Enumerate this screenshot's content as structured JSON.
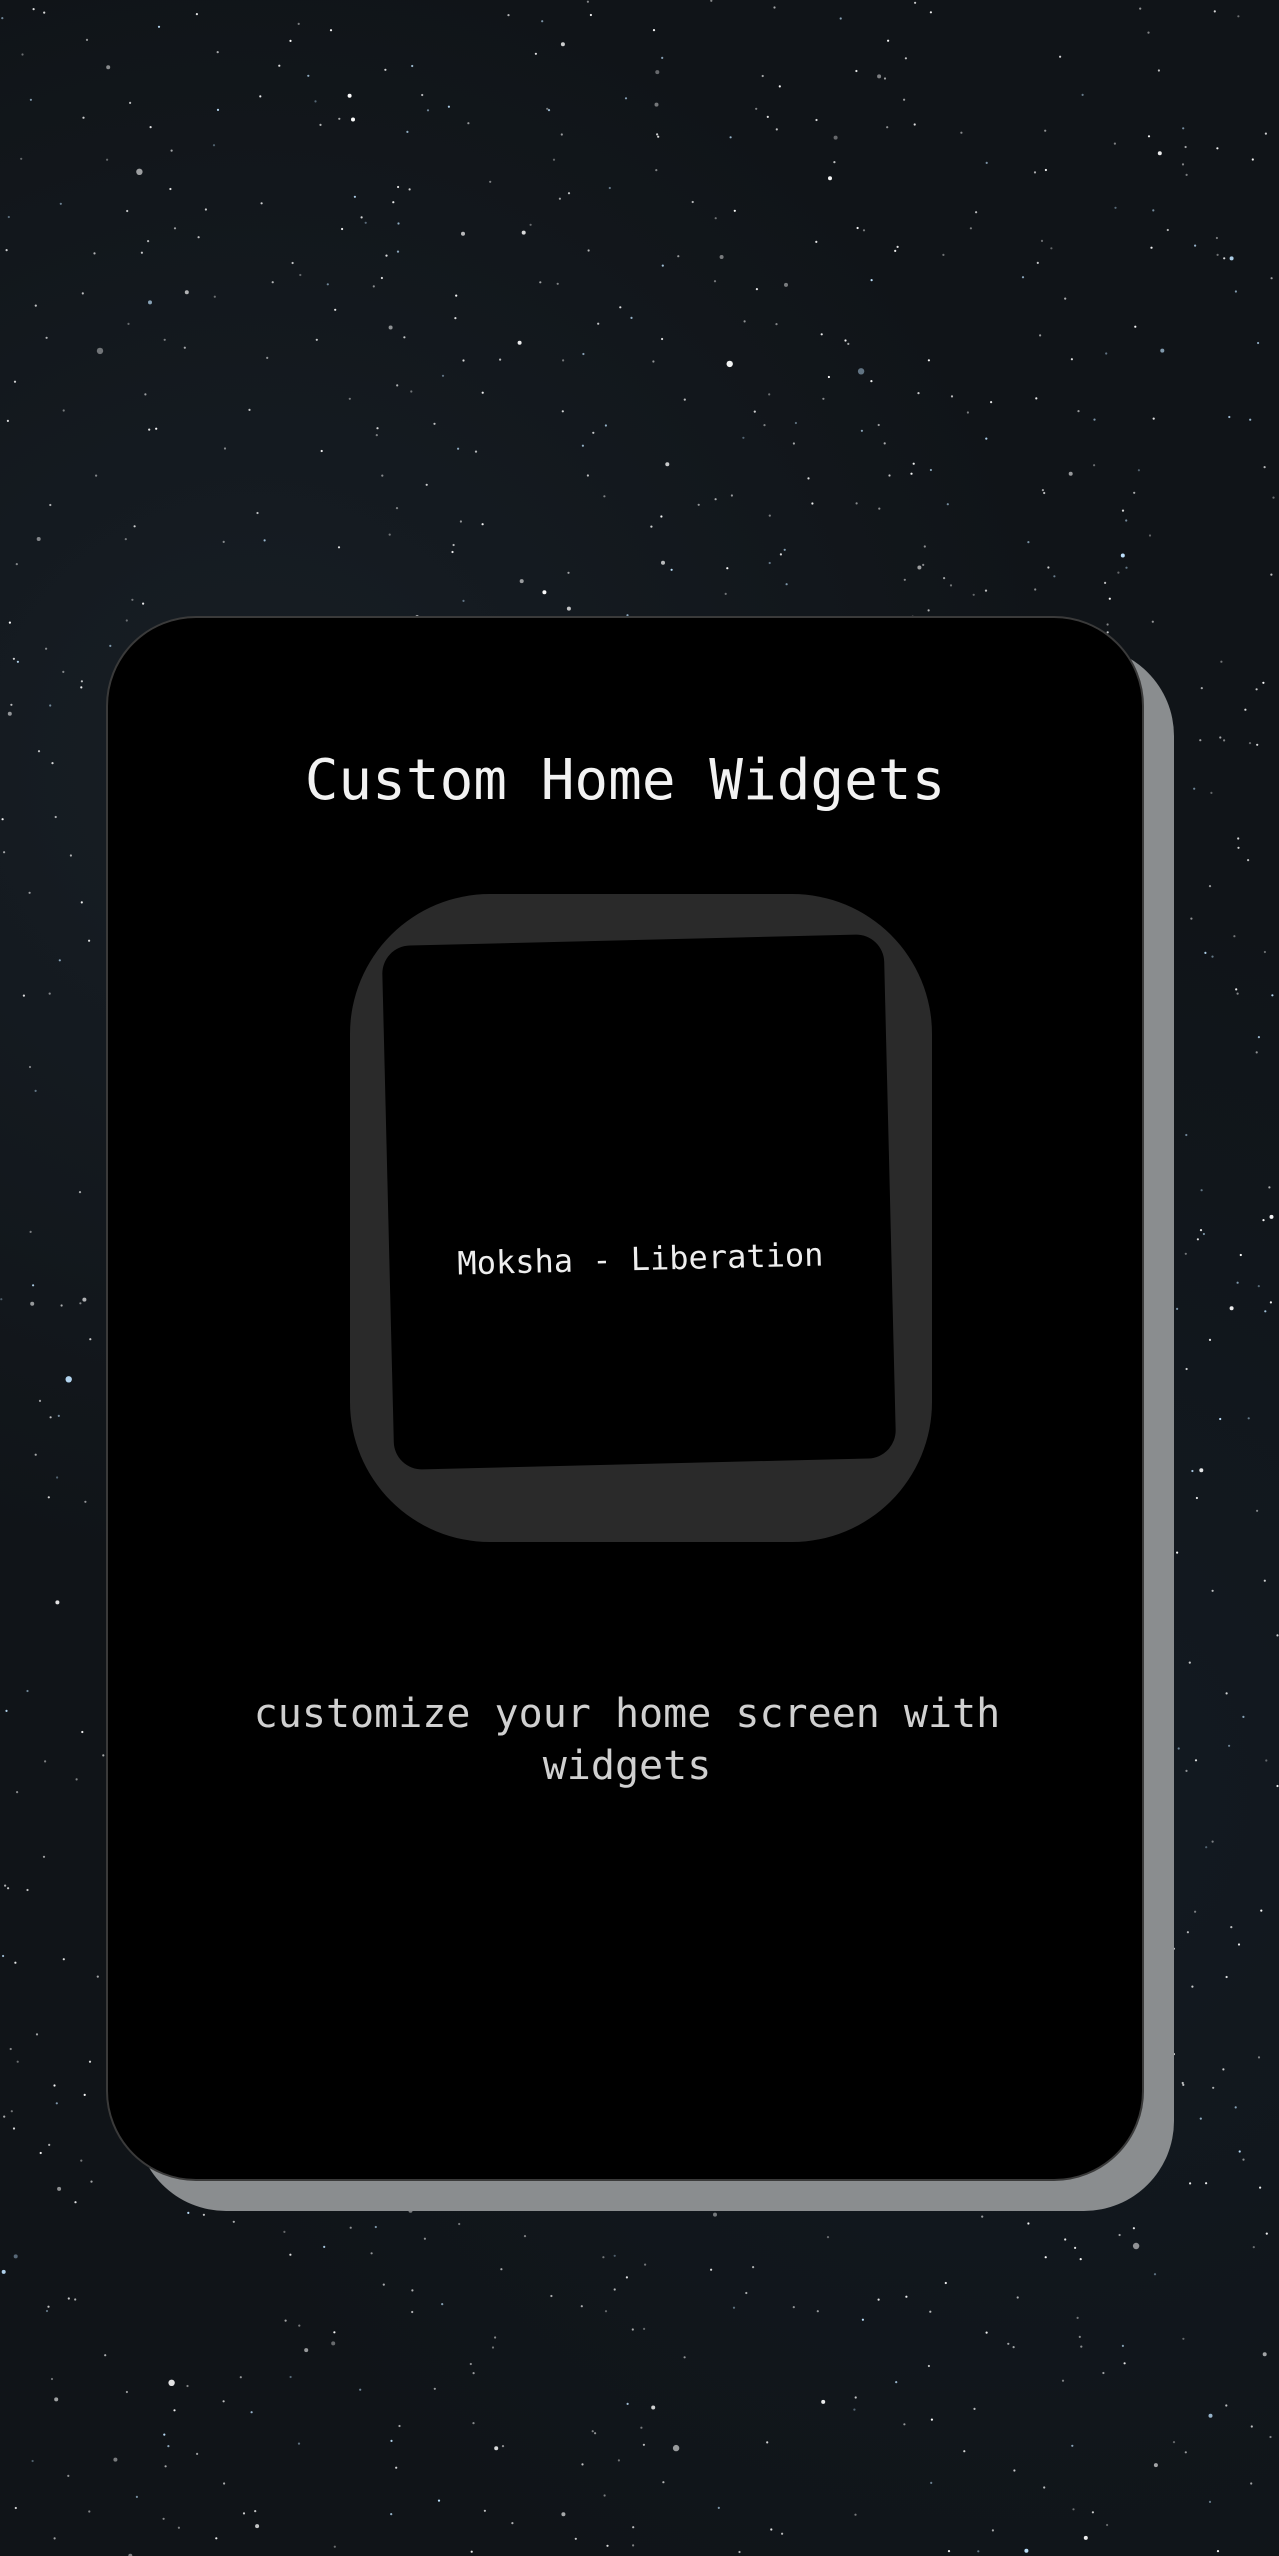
{
  "card": {
    "title": "Custom Home Widgets",
    "subtitle": "customize your home screen with widgets"
  },
  "widget": {
    "label": "Moksha - Liberation"
  },
  "colors": {
    "background": "#101418",
    "card": "#000000",
    "card_shadow": "#8a8d8f",
    "widget_frame": "#2a2a2a",
    "text": "#f2f2f2"
  }
}
